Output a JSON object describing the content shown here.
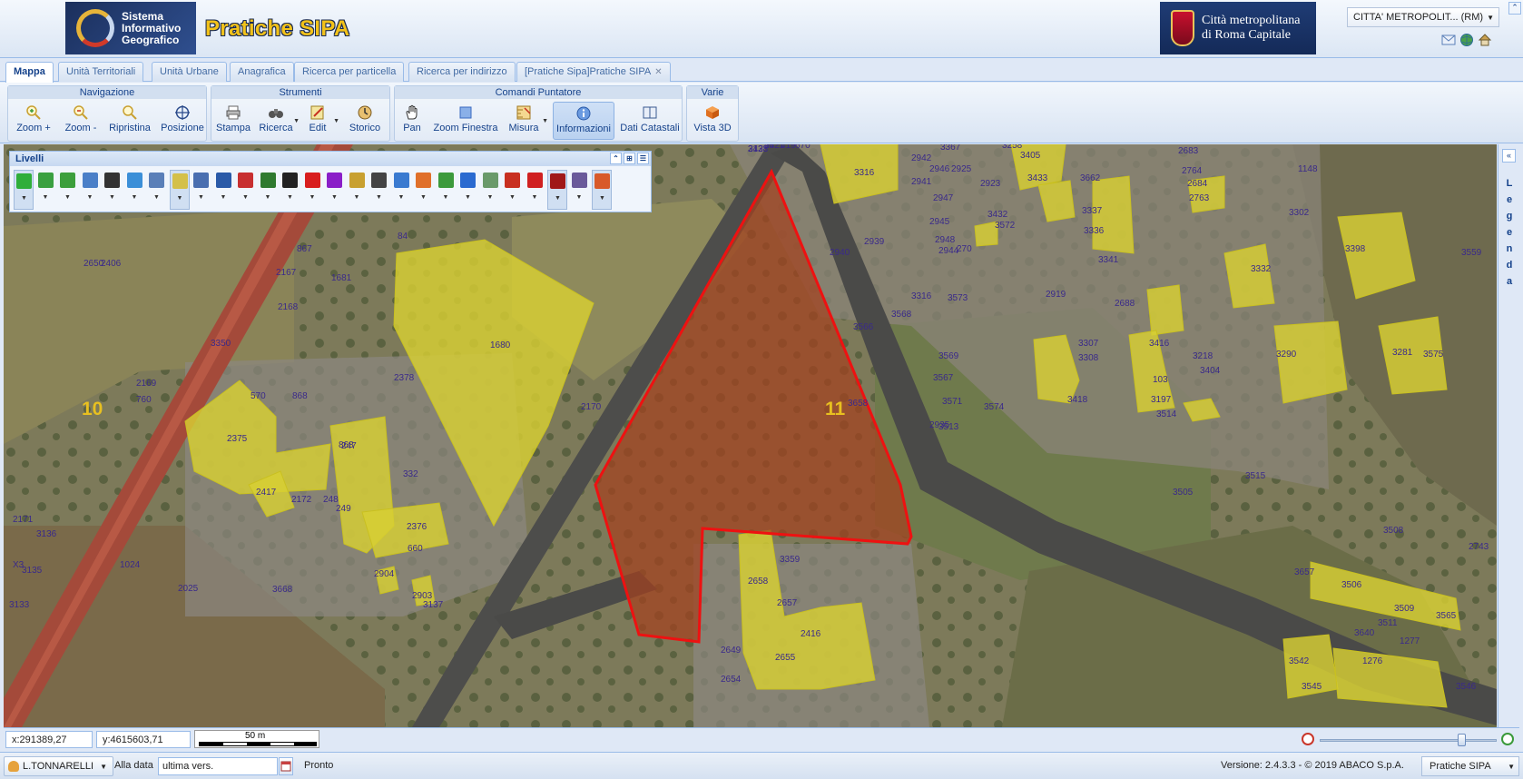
{
  "header": {
    "sig_logo_text": [
      "Sistema",
      "Informativo",
      "Geografico"
    ],
    "app_title": "Pratiche SIPA",
    "authority_logo_text": [
      "Città metropolitana",
      "di Roma Capitale"
    ],
    "entity_select_value": "CITTA' METROPOLIT... (RM)",
    "icons": [
      "mail-icon",
      "globe-icon",
      "home-icon"
    ]
  },
  "tabs": [
    {
      "label": "Mappa",
      "active": true
    },
    {
      "label": "Unità Territoriali"
    },
    {
      "label": "Unità Urbane"
    },
    {
      "label": "Anagrafica"
    },
    {
      "label": "Ricerca per particella"
    },
    {
      "label": "Ricerca per indirizzo"
    },
    {
      "label": "[Pratiche Sipa]Pratiche SIPA",
      "closable": true
    }
  ],
  "toolbar": {
    "navigazione": {
      "title": "Navigazione",
      "buttons": [
        "Zoom +",
        "Zoom -",
        "Ripristina",
        "Posizione"
      ]
    },
    "strumenti": {
      "title": "Strumenti",
      "buttons": [
        "Stampa",
        "Ricerca",
        "Edit",
        "Storico"
      ]
    },
    "puntatore": {
      "title": "Comandi Puntatore",
      "buttons": [
        "Pan",
        "Zoom Finestra",
        "Misura",
        "Informazioni",
        "Dati Catastali"
      ],
      "pressed": "Informazioni"
    },
    "varie": {
      "title": "Varie",
      "buttons": [
        "Vista 3D"
      ]
    }
  },
  "layers_panel": {
    "title": "Livelli",
    "layers": [
      {
        "name": "wms-layer",
        "color": "#2fae3a",
        "on": true
      },
      {
        "name": "ortofoto-layer",
        "color": "#3aa040",
        "on": false
      },
      {
        "name": "osm-layer",
        "color": "#3c9f3c",
        "on": false
      },
      {
        "name": "car-layer",
        "color": "#4a7fc8",
        "on": false
      },
      {
        "name": "camera-layer",
        "color": "#333333",
        "on": false
      },
      {
        "name": "map-layer",
        "color": "#3b8fd8",
        "on": false
      },
      {
        "name": "bus-layer",
        "color": "#5a7fb8",
        "on": false
      },
      {
        "name": "catasto-layer",
        "color": "#d4c04a",
        "on": true
      },
      {
        "name": "vehicle-layer",
        "color": "#4a6fb0",
        "on": false
      },
      {
        "name": "tools-layer",
        "color": "#2a5aa8",
        "on": false
      },
      {
        "name": "building-layer",
        "color": "#c83030",
        "on": false
      },
      {
        "name": "tree-layer",
        "color": "#2f7a2f",
        "on": false
      },
      {
        "name": "warning-layer",
        "color": "#222222",
        "on": false
      },
      {
        "name": "ptpr-layer",
        "color": "#d81e1e",
        "on": false
      },
      {
        "name": "ptpg-layer",
        "color": "#8a1ec8",
        "on": false
      },
      {
        "name": "grid-layer",
        "color": "#c8a030",
        "on": false
      },
      {
        "name": "prg-layer",
        "color": "#444444",
        "on": false
      },
      {
        "name": "road-layer",
        "color": "#3a7ad0",
        "on": false
      },
      {
        "name": "geology-layer",
        "color": "#e0702a",
        "on": false
      },
      {
        "name": "recycle-layer",
        "color": "#3c9a3c",
        "on": false
      },
      {
        "name": "water-layer",
        "color": "#2a6ad0",
        "on": false
      },
      {
        "name": "person-layer",
        "color": "#6a9a6a",
        "on": false
      },
      {
        "name": "target-layer",
        "color": "#c83020",
        "on": false
      },
      {
        "name": "hazard-layer",
        "color": "#d02020",
        "on": false
      },
      {
        "name": "vincoli-layer",
        "color": "#a01818",
        "on": true
      },
      {
        "name": "crest-layer",
        "color": "#6a5a9a",
        "on": false
      },
      {
        "name": "tools2-layer",
        "color": "#d85a2a",
        "on": true
      }
    ]
  },
  "legend_panel": {
    "label": "Legenda"
  },
  "map": {
    "sheet_labels": [
      "10",
      "11"
    ],
    "parcel_labels": [
      "2423",
      "2421",
      "419",
      "670",
      "3367",
      "3258",
      "2683",
      "3316",
      "2942",
      "2946",
      "2925",
      "3405",
      "2764",
      "2941",
      "2923",
      "3433",
      "3662",
      "2684",
      "1148",
      "2947",
      "3432",
      "3337",
      "2763",
      "3302",
      "2945",
      "3572",
      "3336",
      "2939",
      "2948",
      "2944",
      "270",
      "3341",
      "2940",
      "3398",
      "3559",
      "3332",
      "3316",
      "3573",
      "2919",
      "2688",
      "3568",
      "3566",
      "3307",
      "3416",
      "3290",
      "3281",
      "3569",
      "3308",
      "3575",
      "3218",
      "3567",
      "3404",
      "3418",
      "103",
      "3571",
      "3574",
      "3197",
      "3514",
      "2935",
      "3513",
      "3515",
      "3658",
      "3505",
      "3508",
      "2743",
      "3657",
      "3506",
      "3509",
      "3511",
      "3640",
      "3565",
      "1277",
      "3542",
      "1276",
      "3545",
      "3546",
      "3359",
      "2658",
      "2657",
      "2416",
      "2649",
      "2655",
      "2654",
      "2650",
      "84",
      "2406",
      "867",
      "2167",
      "1681",
      "2168",
      "1680",
      "3350",
      "2378",
      "2169",
      "760",
      "570",
      "868",
      "2375",
      "868",
      "247",
      "2170",
      "332",
      "2417",
      "2172",
      "248",
      "249",
      "2376",
      "2171",
      "3136",
      "660",
      "X3",
      "3135",
      "1024",
      "2025",
      "3668",
      "2904",
      "2903",
      "3137",
      "3133",
      "3138",
      "58"
    ]
  },
  "map_status": {
    "x_coord": "x:291389,27",
    "y_coord": "y:4615603,71",
    "scale_label": "50 m",
    "zoom_level": 0.8
  },
  "bottom_bar": {
    "user": "L.TONNARELLI",
    "date_label": "Alla data",
    "date_value": "ultima vers.",
    "status": "Pronto",
    "version": "Versione: 2.4.3.3 - © 2019 ABACO S.p.A.",
    "app_select": "Pratiche SIPA"
  }
}
